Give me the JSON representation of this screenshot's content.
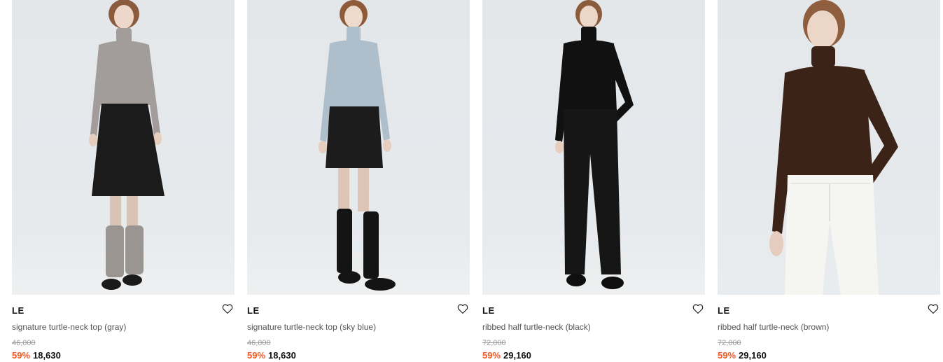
{
  "products": [
    {
      "brand": "LE",
      "name": "signature turtle-neck top (gray)",
      "original_price": "46,000",
      "discount": "59%",
      "sale_price": "18,630",
      "colors": {
        "top": "#a29d9a",
        "bottom": "#1b1b1b",
        "legs": "#d9c3b4",
        "shoes": "#1a1a1a",
        "hair": "#8b5b3d",
        "socks": "#9a9590"
      }
    },
    {
      "brand": "LE",
      "name": "signature turtle-neck top (sky blue)",
      "original_price": "46,000",
      "discount": "59%",
      "sale_price": "18,630",
      "colors": {
        "top": "#aebfcb",
        "bottom": "#1c1c1c",
        "legs": "#dec6b6",
        "shoes": "#141414",
        "hair": "#8d5a3a",
        "socks": "#141414"
      }
    },
    {
      "brand": "LE",
      "name": "ribbed half turtle-neck (black)",
      "original_price": "72,000",
      "discount": "59%",
      "sale_price": "29,160",
      "colors": {
        "top": "#111111",
        "bottom": "#161616",
        "legs": "#161616",
        "shoes": "#0f0f0f",
        "hair": "#8a5b3c",
        "socks": "#161616"
      }
    },
    {
      "brand": "LE",
      "name": "ribbed half turtle-neck (brown)",
      "original_price": "72,000",
      "discount": "59%",
      "sale_price": "29,160",
      "colors": {
        "top": "#3b2318",
        "bottom": "#f5f5f2",
        "legs": "#f5f5f2",
        "shoes": "#f5f5f2",
        "hair": "#8e5e3f",
        "socks": "#f5f5f2"
      }
    }
  ]
}
